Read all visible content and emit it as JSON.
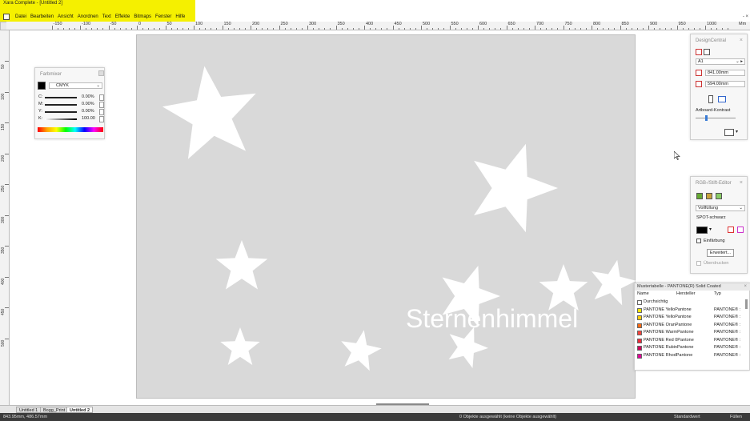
{
  "app": {
    "title": "Xara Complete - [Untitled 2]",
    "close_glyph": "- ×"
  },
  "menu": [
    "Datei",
    "Bearbeiten",
    "Ansicht",
    "Anordnen",
    "Text",
    "Effekte",
    "Bitmaps",
    "Fenster",
    "Hilfe"
  ],
  "ruler": {
    "unit": "Mm",
    "h_labels": [
      "-150",
      "-100",
      "-50",
      "0",
      "50",
      "100",
      "150",
      "200",
      "250",
      "300",
      "350",
      "400",
      "450",
      "500",
      "550",
      "600",
      "650",
      "700",
      "750",
      "800",
      "850",
      "900",
      "950",
      "1000"
    ],
    "v_labels": [
      "50",
      "100",
      "150",
      "200",
      "250",
      "300",
      "350",
      "400",
      "450",
      "500"
    ]
  },
  "canvas": {
    "heading": "Sternenhimmel",
    "artboard_color": "#d9d9d9",
    "star_color": "#ffffff"
  },
  "farbmixer": {
    "title": "Farbmixer",
    "model": "CMYK",
    "channels": [
      {
        "label": "C:",
        "value": "0.00%"
      },
      {
        "label": "M:",
        "value": "0.00%"
      },
      {
        "label": "Y:",
        "value": "0.00%"
      },
      {
        "label": "K:",
        "value": "100.00"
      }
    ]
  },
  "design_central": {
    "title": "DesignCentral",
    "page_size": "A1",
    "width": "841.00mm",
    "height": "594.00mm",
    "section": "Artboard-Kontrast"
  },
  "rgb_editor": {
    "title": "RGB-/Stift-Editor",
    "fill_mode": "Vollfüllung",
    "color_name": "SPOT-schwarz",
    "option1": "Einfärbung",
    "advanced_button": "Erweitert...",
    "option2": "Überdrucken"
  },
  "palette": {
    "title": "Mustertabelle - PANTONE(R) Solid Coated",
    "columns": [
      "Name",
      "Hersteller",
      "Typ"
    ],
    "rows": [
      {
        "name": "Durchsichtig",
        "color": "#ffffff",
        "type": ""
      },
      {
        "name": "PANTONE YelloPantone",
        "color": "#ffe600",
        "type": "PANTONE® :"
      },
      {
        "name": "PANTONE YelloPantone",
        "color": "#ffcc00",
        "type": "PANTONE® :"
      },
      {
        "name": "PANTONE OranPantone",
        "color": "#ff6a13",
        "type": "PANTONE® :"
      },
      {
        "name": "PANTONE WarmPantone",
        "color": "#f9423a",
        "type": "PANTONE® :"
      },
      {
        "name": "PANTONE Red 0Pantone",
        "color": "#ed2939",
        "type": "PANTONE® :"
      },
      {
        "name": "PANTONE RubinPantone",
        "color": "#ce0058",
        "type": "PANTONE® :"
      },
      {
        "name": "PANTONE RhodPantone",
        "color": "#e10098",
        "type": "PANTONE® :"
      }
    ]
  },
  "tabs": [
    "Untitled 1",
    "Bogg_Print",
    "Untitled 2"
  ],
  "status": {
    "left": "843.95mm, 486.57mm",
    "center": "0 Objekte ausgewählt (keine Objekte ausgewählt)",
    "right": "Standardwert",
    "far": "Füllen"
  }
}
